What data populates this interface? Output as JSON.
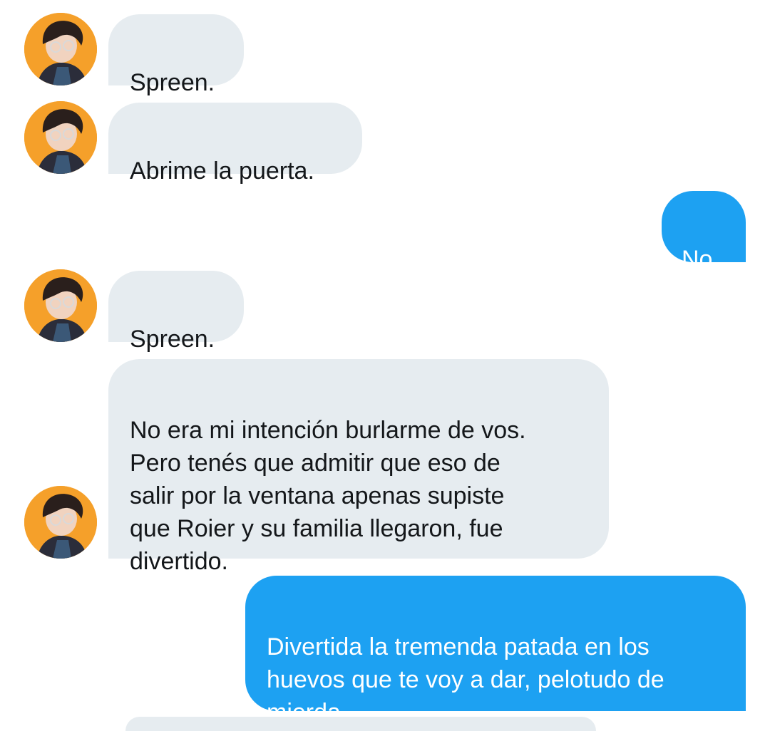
{
  "conversation": {
    "messages": [
      {
        "direction": "incoming",
        "text": "Spreen.",
        "avatar_icon": "contact-avatar-icon"
      },
      {
        "direction": "incoming",
        "text": "Abrime la puerta.",
        "avatar_icon": "contact-avatar-icon"
      },
      {
        "direction": "outgoing",
        "text": "No."
      },
      {
        "direction": "incoming",
        "text": "Spreen.",
        "avatar_icon": "contact-avatar-icon"
      },
      {
        "direction": "incoming",
        "text": "No era mi intención burlarme de vos.\nPero tenés que admitir que eso de\nsalir por la ventana apenas supiste\nque Roier y su familia llegaron, fue\ndivertido.",
        "avatar_icon": "contact-avatar-icon"
      },
      {
        "direction": "outgoing",
        "text": "Divertida la tremenda patada en los\nhuevos que te voy a dar, pelotudo de\nmierda."
      }
    ]
  },
  "colors": {
    "incoming_bubble": "#e6ecf0",
    "incoming_text": "#14171a",
    "outgoing_bubble": "#1da1f2",
    "outgoing_text": "#ffffff",
    "avatar_background": "#f5a02a"
  }
}
